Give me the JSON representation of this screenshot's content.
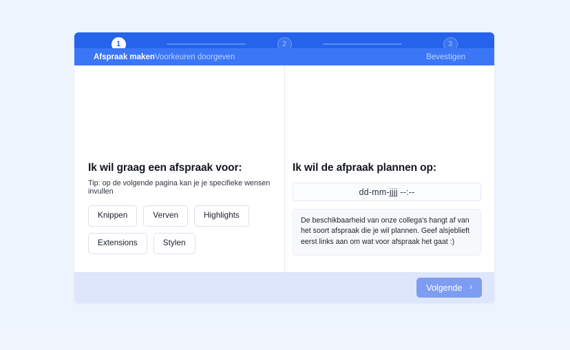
{
  "theme": {
    "page_bg": "#eef4fd",
    "brand_blue": "#2563eb",
    "header_label_bar": "#3b76f6",
    "footer_bg": "#dde6fb",
    "next_button_bg": "#7e9df2",
    "chip_border": "#d9e0ec",
    "info_box_bg": "#f7f8fb"
  },
  "stepper": {
    "steps": [
      {
        "number": "1",
        "label": "Afspraak maken",
        "state": "active"
      },
      {
        "number": "2",
        "label": "Voorkeuren doorgeven",
        "state": "idle"
      },
      {
        "number": "3",
        "label": "Bevestigen",
        "state": "idle"
      }
    ]
  },
  "left_panel": {
    "title": "Ik wil graag een afspraak voor:",
    "hint": "Tip: op de volgende pagina kan je je specifieke wensen invullen",
    "options": [
      {
        "label": "Knippen"
      },
      {
        "label": "Verven"
      },
      {
        "label": "Highlights"
      },
      {
        "label": "Extensions"
      },
      {
        "label": "Stylen"
      }
    ]
  },
  "right_panel": {
    "title": "Ik wil de afpraak plannen op:",
    "datetime_value": "dd-mm-jjjj --:--",
    "datetime_placeholder": "dd-mm-jjjj --:--",
    "info_text": "De beschikbaarheid van onze collega's hangt af van het soort afspraak die je wil plannen. Geef alsjeblieft eerst links aan om wat voor afspraak het gaat :)"
  },
  "footer": {
    "next_label": "Volgende",
    "next_icon": "chevron-right-icon",
    "chevron_glyph": "›"
  }
}
